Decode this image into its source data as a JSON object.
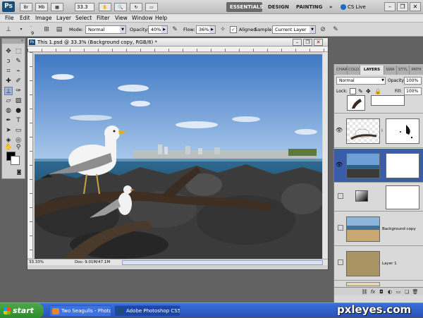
{
  "app": {
    "logo": "Ps",
    "zoom": "33.3",
    "workspaces": [
      "ESSENTIALS",
      "DESIGN",
      "PAINTING"
    ],
    "more": "»",
    "cslive": "CS Live",
    "window_buttons": [
      "–",
      "❐",
      "✕"
    ]
  },
  "menu": [
    "File",
    "Edit",
    "Image",
    "Layer",
    "Select",
    "Filter",
    "View",
    "Window",
    "Help"
  ],
  "options": {
    "brush_size": "9",
    "mode_label": "Mode:",
    "mode_value": "Normal",
    "opacity_label": "Opacity:",
    "opacity_value": "40%",
    "flow_label": "Flow:",
    "flow_value": "36%",
    "aligned_label": "Aligned",
    "aligned_checked": true,
    "sample_label": "Sample:",
    "sample_value": "Current Layer"
  },
  "document": {
    "title": "This 1.psd @ 33.3% (Background copy, RGB/8) *",
    "zoom": "33.33%",
    "info": "Doc: 9.01M/47.1M"
  },
  "layers_panel": {
    "tabs": [
      "CHAR",
      "COLO",
      "LAYERS",
      "SWA",
      "STYL",
      "PATH"
    ],
    "active_tab": "LAYERS",
    "blend_mode": "Normal",
    "opacity_label": "Opacity:",
    "opacity_value": "100%",
    "lock_label": "Lock:",
    "fill_label": "Fill:",
    "fill_value": "100%",
    "layers": [
      {
        "name": "",
        "visible": false,
        "selected": false,
        "kind": "bird"
      },
      {
        "name": "",
        "visible": true,
        "selected": false,
        "kind": "seagull"
      },
      {
        "name": "",
        "visible": true,
        "selected": true,
        "kind": "sea"
      },
      {
        "name": "",
        "visible": false,
        "selected": false,
        "kind": "gradient"
      },
      {
        "name": "Background copy",
        "visible": false,
        "selected": false,
        "kind": "beach"
      },
      {
        "name": "Layer 1",
        "visible": false,
        "selected": false,
        "kind": "sand"
      }
    ]
  },
  "taskbar": {
    "start": "start",
    "tasks": [
      "Two Seagulls - Photo...",
      "Adobe Photoshop CS5"
    ]
  },
  "watermark": "pxleyes.com"
}
